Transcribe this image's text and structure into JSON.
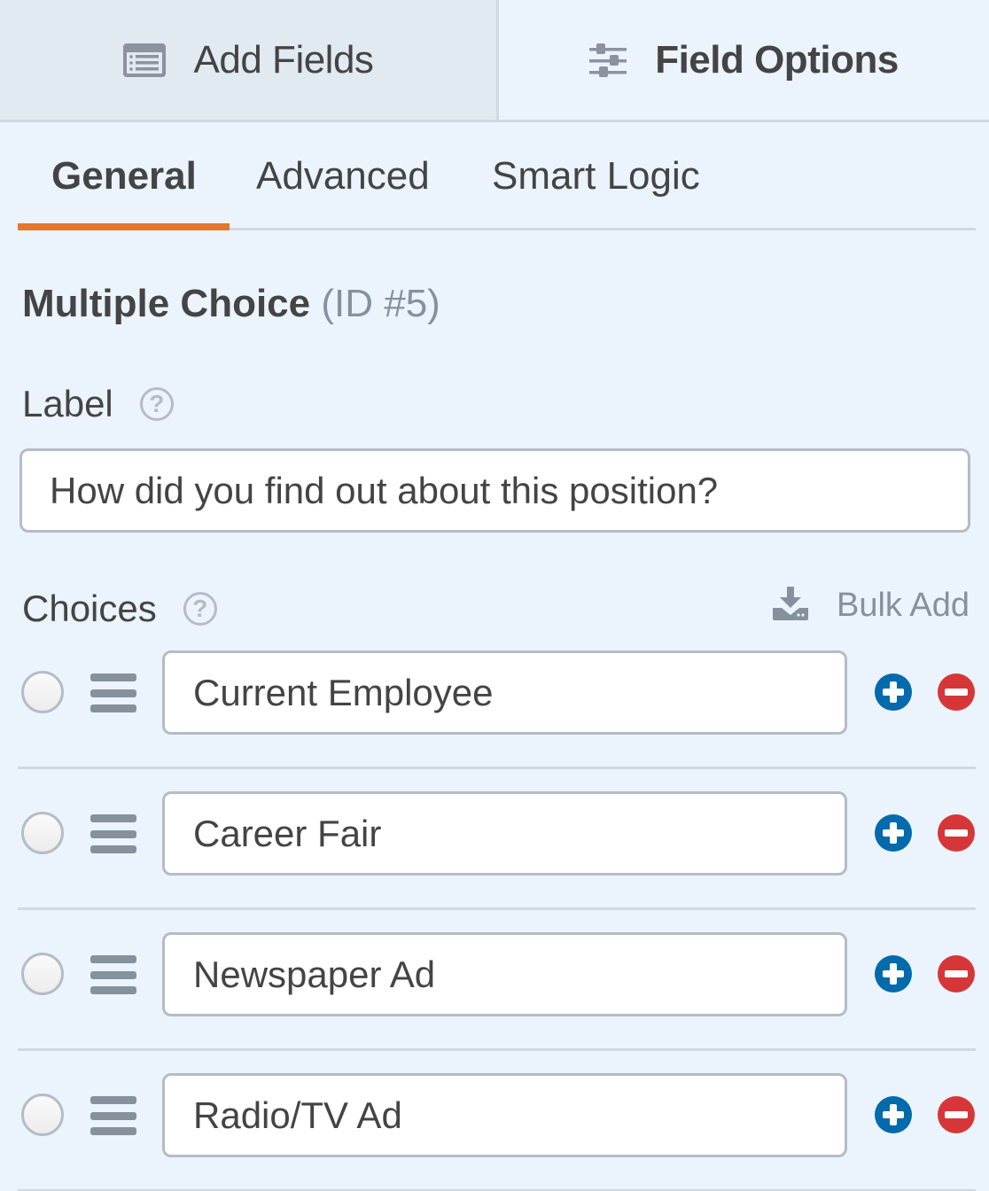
{
  "top_tabs": {
    "add_fields": {
      "label": "Add Fields",
      "icon": "list-form-icon"
    },
    "field_options": {
      "label": "Field Options",
      "icon": "sliders-icon",
      "active": true
    }
  },
  "sub_tabs": [
    {
      "label": "General",
      "active": true
    },
    {
      "label": "Advanced",
      "active": false
    },
    {
      "label": "Smart Logic",
      "active": false
    }
  ],
  "field": {
    "name": "Multiple Choice",
    "id_text": "(ID #5)"
  },
  "label_section": {
    "label": "Label",
    "help_icon": "?",
    "value": "How did you find out about this position?"
  },
  "choices_section": {
    "label": "Choices",
    "help_icon": "?",
    "bulk_add_label": "Bulk Add",
    "items": [
      {
        "value": "Current Employee",
        "selected": false
      },
      {
        "value": "Career Fair",
        "selected": false
      },
      {
        "value": "Newspaper Ad",
        "selected": false
      },
      {
        "value": "Radio/TV Ad",
        "selected": false
      }
    ]
  },
  "colors": {
    "accent": "#e27730",
    "add": "#036aab",
    "remove": "#d63638",
    "text": "#444444",
    "muted": "#86919e",
    "background": "#ebf3fc"
  }
}
